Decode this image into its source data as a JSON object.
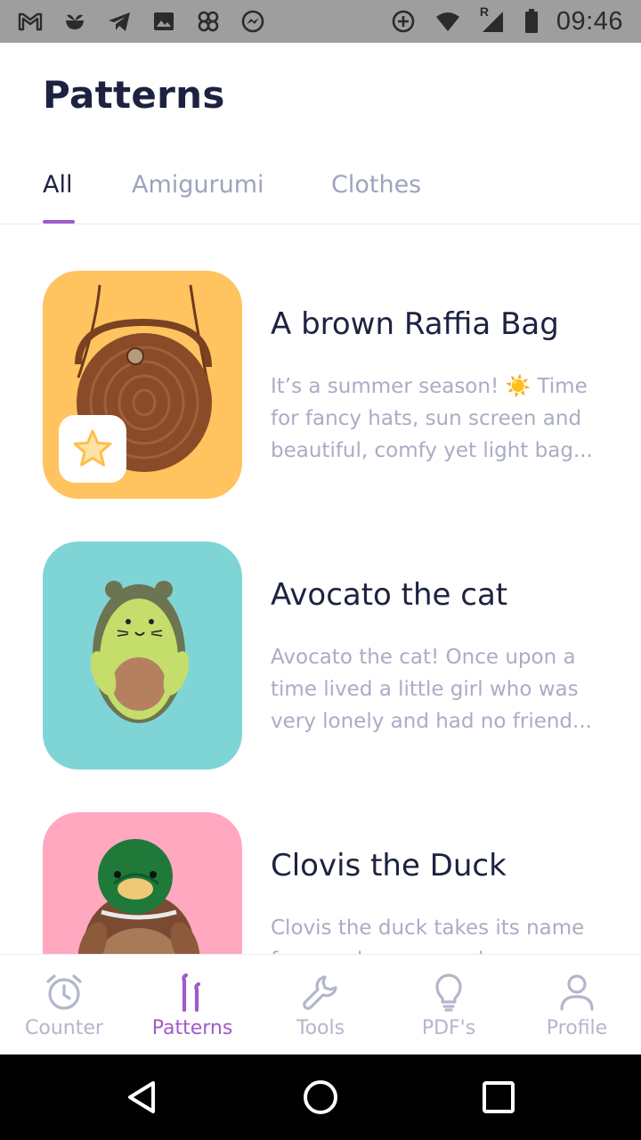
{
  "status_bar": {
    "time": "09:46",
    "left_icons": [
      "gmail-icon",
      "bird-icon",
      "telegram-icon",
      "gallery-icon",
      "pinwheel-icon",
      "messenger-icon"
    ],
    "right_icons": [
      "data-saver-icon",
      "wifi-icon",
      "signal-icon",
      "battery-icon"
    ],
    "signal_label": "R"
  },
  "header": {
    "title": "Patterns"
  },
  "tabs": [
    {
      "label": "All",
      "active": true
    },
    {
      "label": "Amigurumi",
      "active": false
    },
    {
      "label": "Clothes",
      "active": false
    }
  ],
  "patterns": [
    {
      "title": "A brown Raffia Bag",
      "description_lines": [
        "It’s a summer season! ☀️ Time",
        "for fancy hats, sun screen and",
        "beautiful, comfy yet light bag..."
      ],
      "thumb_color": "#ffc35f",
      "favorite": true,
      "image_icon": "raffia-bag-icon"
    },
    {
      "title": "Avocato the cat",
      "description_lines": [
        "Avocato the cat! Once upon a",
        "time lived a little girl who was",
        "very lonely and had no friend..."
      ],
      "thumb_color": "#7fd5d6",
      "favorite": false,
      "image_icon": "avocado-cat-icon"
    },
    {
      "title": "Clovis the Duck",
      "description_lines": [
        "Clovis the duck takes its name",
        "from a place somewhere..."
      ],
      "thumb_color": "#ffa8c0",
      "favorite": false,
      "image_icon": "duck-icon"
    }
  ],
  "bottom_nav": [
    {
      "label": "Counter",
      "icon": "alarm-clock-icon",
      "active": false
    },
    {
      "label": "Patterns",
      "icon": "crochet-hooks-icon",
      "active": true
    },
    {
      "label": "Tools",
      "icon": "wrench-icon",
      "active": false
    },
    {
      "label": "PDF's",
      "icon": "lightbulb-icon",
      "active": false
    },
    {
      "label": "Profile",
      "icon": "person-icon",
      "active": false
    }
  ],
  "colors": {
    "accent": "#a05bc7",
    "title_text": "#1c2240",
    "muted_text": "#a9adc4",
    "nav_inactive": "#b3b6cc"
  }
}
